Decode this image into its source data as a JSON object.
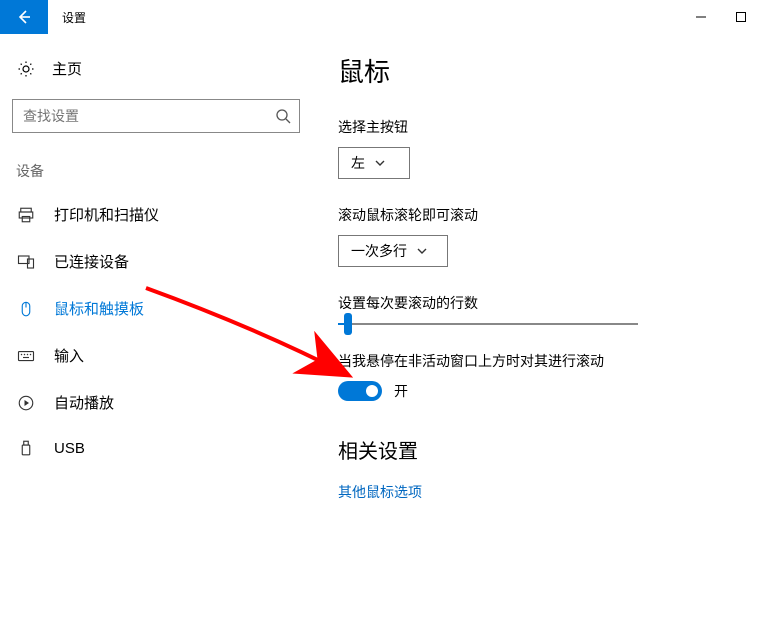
{
  "window": {
    "title": "设置"
  },
  "sidebar": {
    "home": "主页",
    "search_placeholder": "查找设置",
    "group": "设备",
    "items": [
      {
        "label": "打印机和扫描仪"
      },
      {
        "label": "已连接设备"
      },
      {
        "label": "鼠标和触摸板"
      },
      {
        "label": "输入"
      },
      {
        "label": "自动播放"
      },
      {
        "label": "USB"
      }
    ],
    "selected_index": 2
  },
  "main": {
    "title": "鼠标",
    "primary_button": {
      "label": "选择主按钮",
      "value": "左"
    },
    "scroll_mode": {
      "label": "滚动鼠标滚轮即可滚动",
      "value": "一次多行"
    },
    "lines_per_scroll": {
      "label": "设置每次要滚动的行数"
    },
    "inactive_hover": {
      "label": "当我悬停在非活动窗口上方时对其进行滚动",
      "state": "开"
    },
    "related": {
      "title": "相关设置",
      "link": "其他鼠标选项"
    }
  }
}
